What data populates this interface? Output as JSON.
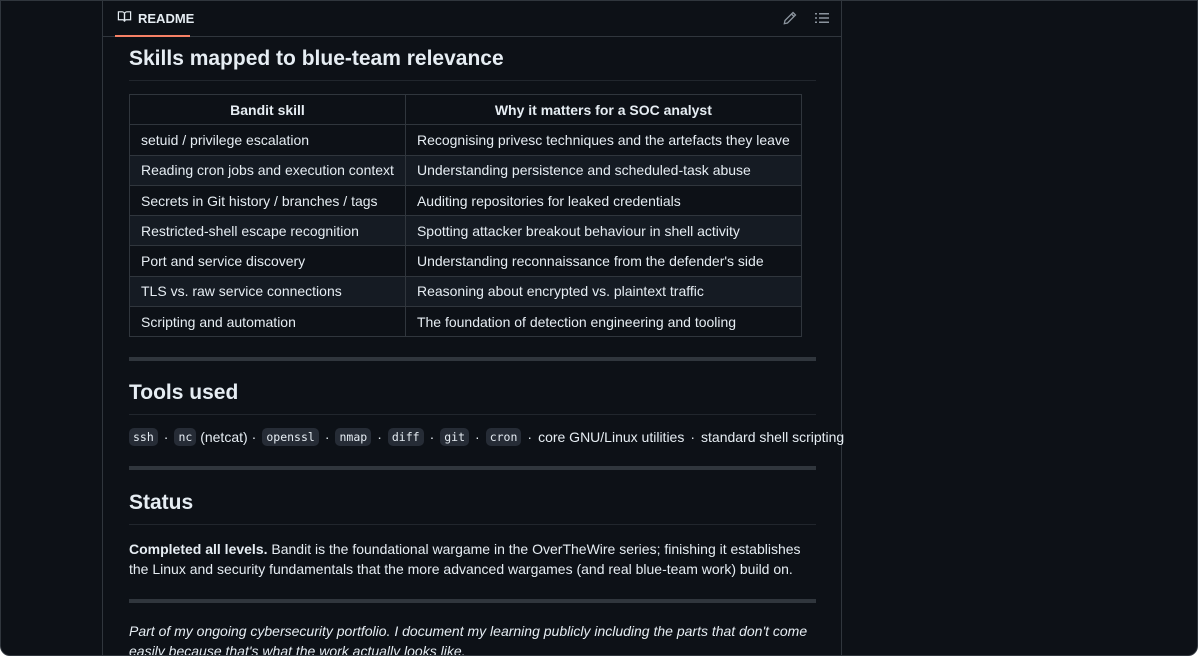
{
  "readme": {
    "tab_label": "README",
    "icons": {
      "book": "book-icon",
      "edit": "pencil-icon",
      "toc": "list-icon"
    }
  },
  "skills": {
    "heading": "Skills mapped to blue-team relevance",
    "table": {
      "headers": [
        "Bandit skill",
        "Why it matters for a SOC analyst"
      ],
      "rows": [
        [
          "setuid / privilege escalation",
          "Recognising privesc techniques and the artefacts they leave"
        ],
        [
          "Reading cron jobs and execution context",
          "Understanding persistence and scheduled-task abuse"
        ],
        [
          "Secrets in Git history / branches / tags",
          "Auditing repositories for leaked credentials"
        ],
        [
          "Restricted-shell escape recognition",
          "Spotting attacker breakout behaviour in shell activity"
        ],
        [
          "Port and service discovery",
          "Understanding reconnaissance from the defender's side"
        ],
        [
          "TLS vs. raw service connections",
          "Reasoning about encrypted vs. plaintext traffic"
        ],
        [
          "Scripting and automation",
          "The foundation of detection engineering and tooling"
        ]
      ]
    }
  },
  "tools": {
    "heading": "Tools used",
    "items": [
      {
        "code": "ssh"
      },
      {
        "code": "nc",
        "suffix": " (netcat)"
      },
      {
        "code": "openssl"
      },
      {
        "code": "nmap"
      },
      {
        "code": "diff"
      },
      {
        "code": "git"
      },
      {
        "code": "cron"
      },
      {
        "text": "core GNU/Linux utilities"
      },
      {
        "text": "standard shell scripting"
      }
    ],
    "separator": "·"
  },
  "status": {
    "heading": "Status",
    "bold": "Completed all levels.",
    "text": " Bandit is the foundational wargame in the OverTheWire series; finishing it establishes the Linux and security fundamentals that the more advanced wargames (and real blue-team work) build on."
  },
  "closing": "Part of my ongoing cybersecurity portfolio. I document my learning publicly including the parts that don't come easily because that's what the work actually looks like.",
  "colors": {
    "background": "#0d1117",
    "border": "#30363d",
    "tab_accent": "#f78166",
    "text": "#e6edf3"
  }
}
